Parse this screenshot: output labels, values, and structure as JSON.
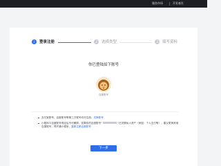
{
  "header": {
    "nav_items": [
      {
        "label": "服务市场"
      },
      {
        "label": "开发者社"
      }
    ]
  },
  "steps": [
    {
      "number": "1",
      "label": "登录注册",
      "active": true
    },
    {
      "number": "2",
      "label": "选择类型",
      "active": false
    },
    {
      "number": "3",
      "label": "填写资料",
      "active": false
    }
  ],
  "account_notice": "你已登陆如下账号",
  "avatar": {
    "name": "百度账号"
  },
  "tips": {
    "tip1_text": "支付宝账号、百度账号等第三方账号均可注册，",
    "tip1_link": "切换账号",
    "tip2_text": "小程序与百度账号绑定后不可解绑，如果你的百度账号“",
    "tip2_text_b": "”已关联私人资产（例如：个人支付等），建议更换其他百度账号，再开通小程序，",
    "tip2_link": "重新注册百度账号"
  },
  "next_button": {
    "label": "下一步"
  },
  "colors": {
    "accent": "#2f6ee6",
    "topbar": "#1c1e22",
    "background": "#f3f4f6"
  }
}
